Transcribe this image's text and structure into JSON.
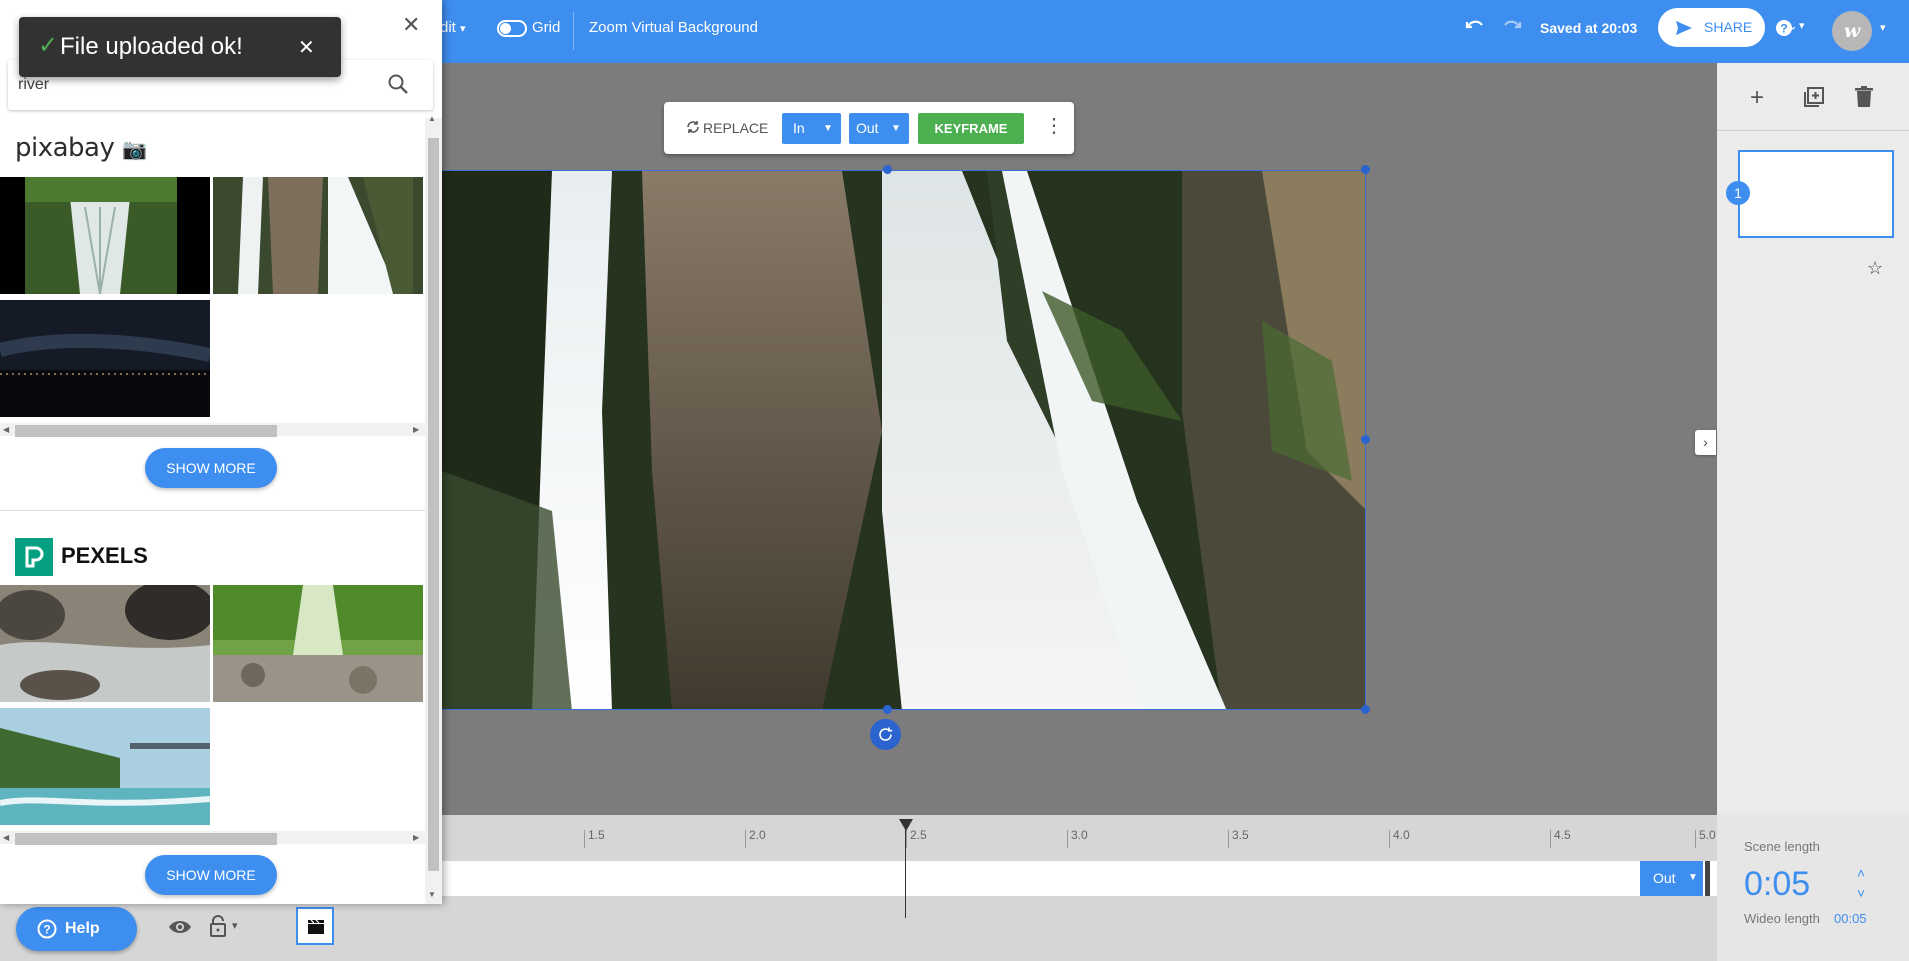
{
  "header": {
    "edit_menu": "dit",
    "grid_label": "Grid",
    "project_title": "Zoom Virtual Background",
    "saved_status": "Saved at 20:03",
    "share_label": "SHARE",
    "help_icon": "question-icon",
    "avatar_letter": "w"
  },
  "toast": {
    "message": "File uploaded ok!",
    "icon": "check-icon"
  },
  "search": {
    "value": "river",
    "placeholder": ""
  },
  "sources": [
    {
      "name": "pixabay",
      "show_more": "SHOW MORE"
    },
    {
      "name": "PEXELS",
      "show_more": "SHOW MORE"
    }
  ],
  "element_toolbar": {
    "replace_label": "REPLACE",
    "in_label": "In",
    "out_label": "Out",
    "keyframe_label": "KEYFRAME"
  },
  "scenes": {
    "number": "1"
  },
  "timeline": {
    "ticks": [
      "1.5",
      "2.0",
      "2.5",
      "3.0",
      "3.5",
      "4.0",
      "4.5",
      "5.0"
    ],
    "out_label": "Out",
    "playhead": "2.5"
  },
  "scene_length": {
    "label": "Scene length",
    "value": "0:05",
    "wideo_length_label": "Wideo length",
    "wideo_length_value": "00:05"
  },
  "help": {
    "label": "Help"
  },
  "colors": {
    "accent": "#3e8ef0",
    "keyframe": "#4caf50",
    "toast_bg": "#323232",
    "pexels": "#05a081"
  }
}
